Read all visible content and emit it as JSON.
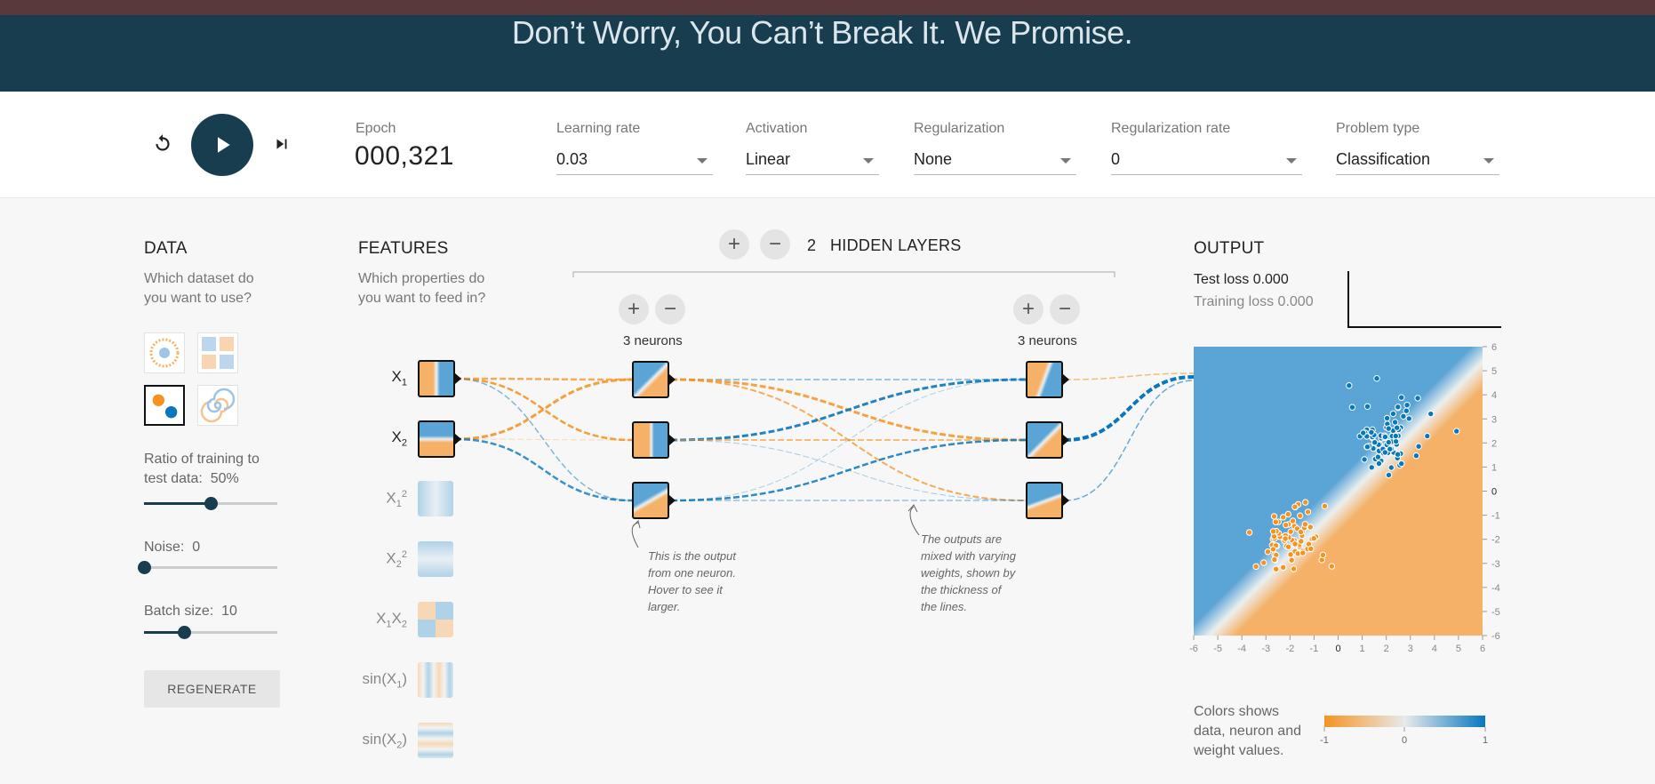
{
  "banner": {
    "title": "Don’t Worry, You Can’t Break It. We Promise."
  },
  "controls": {
    "epoch_label": "Epoch",
    "epoch_value": "000,321",
    "learning_rate": {
      "label": "Learning rate",
      "value": "0.03"
    },
    "activation": {
      "label": "Activation",
      "value": "Linear"
    },
    "regularization": {
      "label": "Regularization",
      "value": "None"
    },
    "regularization_rate": {
      "label": "Regularization rate",
      "value": "0"
    },
    "problem_type": {
      "label": "Problem type",
      "value": "Classification"
    }
  },
  "data_panel": {
    "title": "DATA",
    "subtitle": "Which dataset do you want to use?",
    "datasets": [
      "circle",
      "xor",
      "gaussian",
      "spiral"
    ],
    "selected_dataset": "gaussian",
    "ratio": {
      "label": "Ratio of training to test data:",
      "value": "50%",
      "fraction": 0.5
    },
    "noise": {
      "label": "Noise:",
      "value": "0",
      "fraction": 0.0
    },
    "batch": {
      "label": "Batch size:",
      "value": "10",
      "fraction": 0.3
    },
    "regenerate": "REGENERATE"
  },
  "features_panel": {
    "title": "FEATURES",
    "subtitle": "Which properties do you want to feed in?",
    "features": [
      {
        "base": "X",
        "sub": "1",
        "sup": "",
        "active": true
      },
      {
        "base": "X",
        "sub": "2",
        "sup": "",
        "active": true
      },
      {
        "base": "X",
        "sub": "1",
        "sup": "2",
        "active": false
      },
      {
        "base": "X",
        "sub": "2",
        "sup": "2",
        "active": false
      },
      {
        "base": "X",
        "sub": "1",
        "sup": "",
        "base2": "X",
        "sub2": "2",
        "active": false
      },
      {
        "base": "sin(X",
        "sub": "1",
        "sup": "",
        "close": ")",
        "active": false
      },
      {
        "base": "sin(X",
        "sub": "2",
        "sup": "",
        "close": ")",
        "active": false
      }
    ]
  },
  "network": {
    "hidden_layers_count": "2",
    "hidden_layers_label": "HIDDEN LAYERS",
    "add_layer": "+",
    "remove_layer": "−",
    "layers": [
      {
        "neurons_label": "3 neurons",
        "add": "+",
        "remove": "−"
      },
      {
        "neurons_label": "3 neurons",
        "add": "+",
        "remove": "−"
      }
    ],
    "note_neuron": [
      "This is the output",
      "from one neuron.",
      "Hover to see it",
      "larger."
    ],
    "note_weights": [
      "The outputs are",
      "mixed with varying",
      "weights, shown by",
      "the thickness of",
      "the lines."
    ]
  },
  "output_panel": {
    "title": "OUTPUT",
    "test_loss": "Test loss 0.000",
    "training_loss": "Training loss 0.000",
    "y_ticks": [
      "6",
      "5",
      "4",
      "3",
      "2",
      "1",
      "0",
      "-1",
      "-2",
      "-3",
      "-4",
      "-5",
      "-6"
    ],
    "x_ticks": [
      "-6",
      "-5",
      "-4",
      "-3",
      "-2",
      "-1",
      "0",
      "1",
      "2",
      "3",
      "4",
      "5",
      "6"
    ],
    "legend_text": [
      "Colors shows",
      "data, neuron and",
      "weight values."
    ],
    "legend_ticks": [
      "-1",
      "0",
      "1"
    ],
    "colors": {
      "orange": "#f59322",
      "blue": "#0877bd",
      "neutral": "#e8eaeb"
    }
  }
}
